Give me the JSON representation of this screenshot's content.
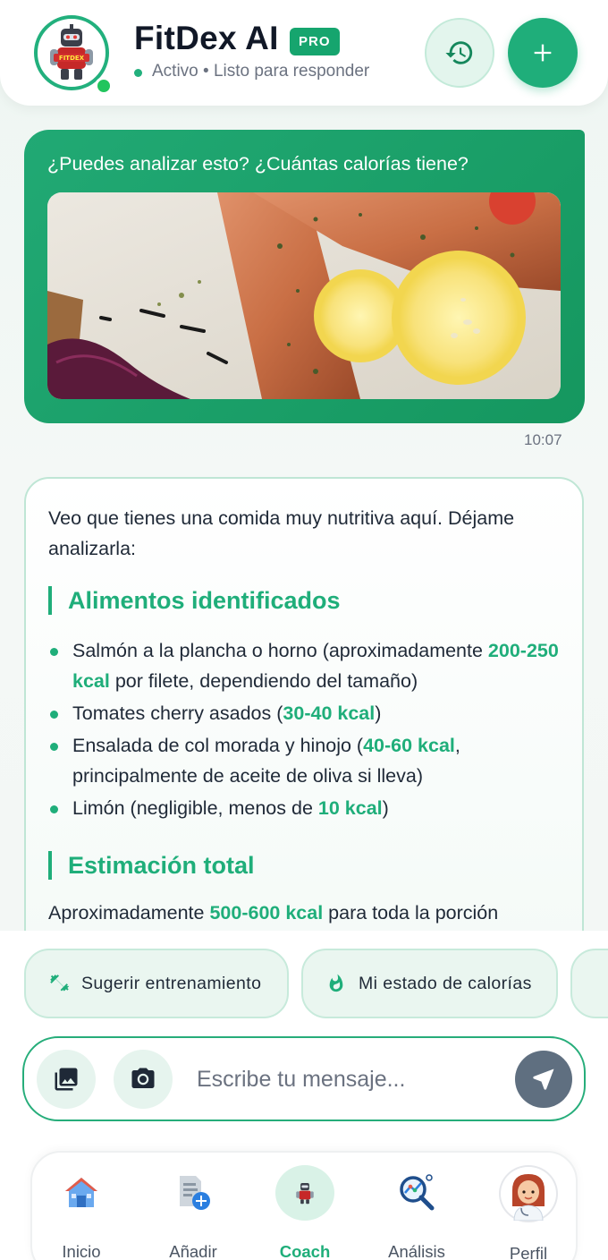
{
  "header": {
    "title": "FitDex AI",
    "badge": "PRO",
    "status": "Activo • Listo para responder",
    "logo_text": "FITDEX"
  },
  "chat": {
    "user_message": {
      "text": "¿Puedes analizar esto? ¿Cuántas calorías tiene?",
      "time": "10:07"
    },
    "ai_message": {
      "intro": "Veo que tienes una comida muy nutritiva aquí. Déjame analizarla:",
      "section1_title": "Alimentos identificados",
      "items": [
        {
          "pre": "Salmón a la plancha o horno (aproximadamente ",
          "kcal": "200-250 kcal",
          "post": " por filete, dependiendo del tamaño)"
        },
        {
          "pre": "Tomates cherry asados (",
          "kcal": "30-40 kcal",
          "post": ")"
        },
        {
          "pre": "Ensalada de col morada y hinojo (",
          "kcal": "40-60 kcal",
          "post": ", principalmente de aceite de oliva si lleva)"
        },
        {
          "pre": "Limón (negligible, menos de ",
          "kcal": "10 kcal",
          "post": ")"
        }
      ],
      "section2_title": "Estimación total",
      "total_pre": "Aproximadamente ",
      "total_kcal": "500-600 kcal",
      "total_post": " para toda la porción"
    }
  },
  "suggestions": [
    {
      "label": "Sugerir entrenamiento",
      "icon": "dumbbell-icon"
    },
    {
      "label": "Mi estado de calorías",
      "icon": "flame-icon"
    }
  ],
  "composer": {
    "placeholder": "Escribe tu mensaje..."
  },
  "nav": [
    {
      "label": "Inicio",
      "icon": "home-icon"
    },
    {
      "label": "Añadir",
      "icon": "add-document-icon"
    },
    {
      "label": "Coach",
      "icon": "robot-coach-icon",
      "active": true
    },
    {
      "label": "Análisis",
      "icon": "analysis-magnifier-icon"
    },
    {
      "label": "Perfil",
      "icon": "profile-avatar-icon"
    }
  ],
  "colors": {
    "accent": "#1fae7a",
    "user_bubble": "#1aa36b",
    "send_button": "#5f6f80"
  }
}
